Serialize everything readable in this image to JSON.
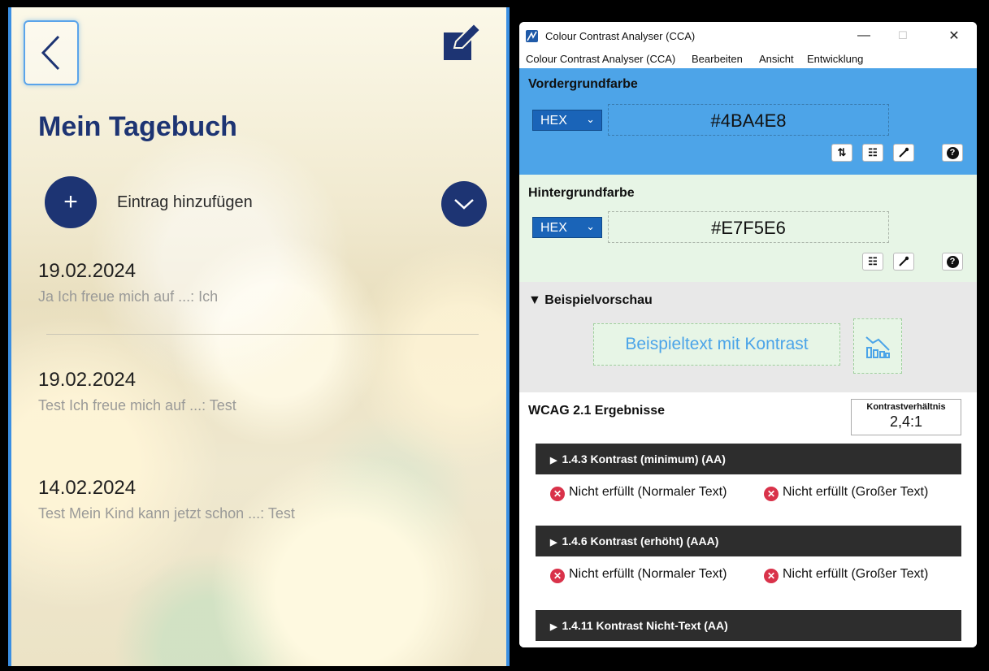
{
  "diary_app": {
    "title": "Mein Tagebuch",
    "add_entry_label": "Eintrag hinzufügen",
    "add_symbol": "+",
    "entries": [
      {
        "date": "19.02.2024",
        "text": "Ja Ich freue mich auf ...: Ich"
      },
      {
        "date": "19.02.2024",
        "text": "Test Ich freue mich auf ...: Test"
      },
      {
        "date": "14.02.2024",
        "text": "Test Mein Kind kann jetzt schon ...: Test"
      }
    ],
    "colors": {
      "primary": "#1d3473",
      "focus": "#4aa4e8"
    }
  },
  "cca": {
    "window_title": "Colour Contrast Analyser (CCA)",
    "window_controls": {
      "minimize": "—",
      "maximize": "☐",
      "close": "✕"
    },
    "menu": [
      "Colour Contrast Analyser (CCA)",
      "Bearbeiten",
      "Ansicht",
      "Entwicklung"
    ],
    "foreground": {
      "title": "Vordergrundfarbe",
      "format": "HEX",
      "value": "#4BA4E8",
      "tools": {
        "swap": "⇅",
        "adjust": "☷",
        "picker": "eyedropper-icon",
        "help": "?"
      }
    },
    "background": {
      "title": "Hintergrundfarbe",
      "format": "HEX",
      "value": "#E7F5E6",
      "tools": {
        "adjust": "☷",
        "picker": "eyedropper-icon",
        "help": "?"
      }
    },
    "preview": {
      "title": "Beispielvorschau",
      "toggle": "▼",
      "sample_text": "Beispieltext mit Kontrast"
    },
    "results": {
      "title": "WCAG 2.1 Ergebnisse",
      "ratio_label": "Kontrastverhältnis",
      "ratio_value": "2,4:1",
      "criteria": [
        {
          "label": "1.4.3 Kontrast (minimum) (AA)",
          "normal": "Nicht erfüllt (Normaler Text)",
          "large": "Nicht erfüllt (Großer Text)"
        },
        {
          "label": "1.4.6 Kontrast (erhöht) (AAA)",
          "normal": "Nicht erfüllt (Normaler Text)",
          "large": "Nicht erfüllt (Großer Text)"
        },
        {
          "label": "1.4.11 Kontrast Nicht-Text (AA)"
        }
      ]
    },
    "colors": {
      "foreground": "#4BA4E8",
      "background": "#E7F5E6",
      "fail": "#d9324a",
      "bar": "#2d2d2d"
    }
  }
}
